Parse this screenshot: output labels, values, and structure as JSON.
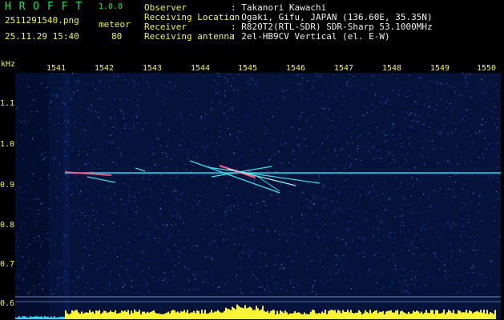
{
  "header": {
    "app_title": "H R O F F T",
    "version": "1.0.0",
    "filename": "2511291540.png",
    "timestamp": "25.11.29 15:40",
    "mode_label": "meteor",
    "mode_value": "80"
  },
  "station": {
    "observer_label": "Observer",
    "observer_value": ": Takanori Kawachi",
    "location_label": "Receiving Location",
    "location_value": ": Ogaki, Gifu, JAPAN (136.60E, 35.35N)",
    "receiver_label": "Receiver",
    "receiver_value": ": R820T2(RTL-SDR) SDR-Sharp 53.1000MHz",
    "antenna_label": "Receiving antenna",
    "antenna_value": ": 2el-HB9CV Vertical (el. E-W)"
  },
  "axes": {
    "y_unit": "kHz",
    "y_ticks": [
      "1.1",
      "1.0",
      "0.9",
      "0.8",
      "0.7",
      "0.6"
    ],
    "x_ticks": [
      "1541",
      "1542",
      "1543",
      "1544",
      "1545",
      "1546",
      "1547",
      "1548",
      "1549",
      "1550"
    ]
  },
  "colors": {
    "background": "#000000",
    "spectrum_bg": "#05123a",
    "noise": "#1f3fb0",
    "signal": "#40e0e8",
    "meteor_core": "#ff5a8a",
    "level_bar": "#f6f33a",
    "accent_green": "#2fe34a",
    "accent_yellow": "#f3f35a"
  }
}
